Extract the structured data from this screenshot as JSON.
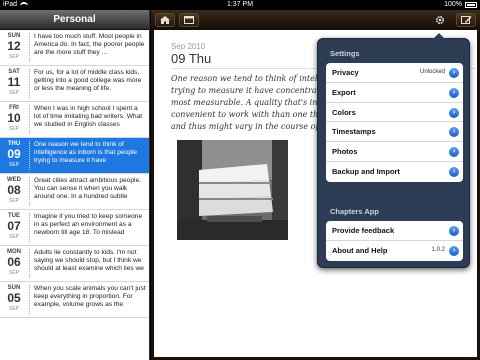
{
  "status_bar": {
    "carrier": "iPad",
    "time": "1:37 PM",
    "battery": "100%"
  },
  "sidebar": {
    "title": "Personal",
    "entries": [
      {
        "dow": "SUN",
        "day": "12",
        "month": "SEP",
        "text": "I have too much stuff. Most people in America do. In fact, the poorer people are the more stuff they ..."
      },
      {
        "dow": "SAT",
        "day": "11",
        "month": "SEP",
        "text": "For us, for a lot of middle class kids, getting into a good college was more or less the meaning of life."
      },
      {
        "dow": "FRI",
        "day": "10",
        "month": "SEP",
        "text": "When I was in high school I spent a lot of time imitating bad writers. What we studied in English classes"
      },
      {
        "dow": "THU",
        "day": "09",
        "month": "SEP",
        "text": "One reason we tend to think of intelligence as inborn is that people trying to measure it have"
      },
      {
        "dow": "WED",
        "day": "08",
        "month": "SEP",
        "text": "Great cities attract ambitious people. You can sense it when you walk around one. In a hundred subtle"
      },
      {
        "dow": "TUE",
        "day": "07",
        "month": "SEP",
        "text": "Imagine if you tried to keep someone in as perfect an environment as a newborn till age 18. To mislead"
      },
      {
        "dow": "MON",
        "day": "06",
        "month": "SEP",
        "text": "Adults lie constantly to kids. I'm not saying we should stop, but I think we should at least examine which lies we"
      },
      {
        "dow": "SUN",
        "day": "05",
        "month": "SEP",
        "text": "When you scale animals you can't just keep everything in proportion. For example, volume grows as the"
      }
    ]
  },
  "toolbar": {
    "home_icon": "home-icon",
    "window_icon": "window-icon",
    "settings_icon": "gear-icon",
    "compose_icon": "compose-icon"
  },
  "entry": {
    "date_small": "Sep 2010",
    "date_main": "09 Thu",
    "body": "One reason we tend to think of intellige\ntrying to measure it have concentrated\nmost measurable. A quality that's inbo\nconvenient to work with than one that's\nand thus might vary in the course of a"
  },
  "settings_popover": {
    "settings_title": "Settings",
    "settings_items": [
      {
        "label": "Privacy",
        "value": "Unlocked"
      },
      {
        "label": "Export",
        "value": ""
      },
      {
        "label": "Colors",
        "value": ""
      },
      {
        "label": "Timestamps",
        "value": ""
      },
      {
        "label": "Photos",
        "value": ""
      },
      {
        "label": "Backup and Import",
        "value": ""
      }
    ],
    "app_title": "Chapters App",
    "app_items": [
      {
        "label": "Provide feedback",
        "value": ""
      },
      {
        "label": "About and Help",
        "value": "1.0.2"
      }
    ]
  },
  "colors": {
    "selected_row": "#1f78e0",
    "popover_bg": "#2c3d55",
    "disclosure": "#1c5cc4",
    "toolbar": "#2b1d12"
  }
}
